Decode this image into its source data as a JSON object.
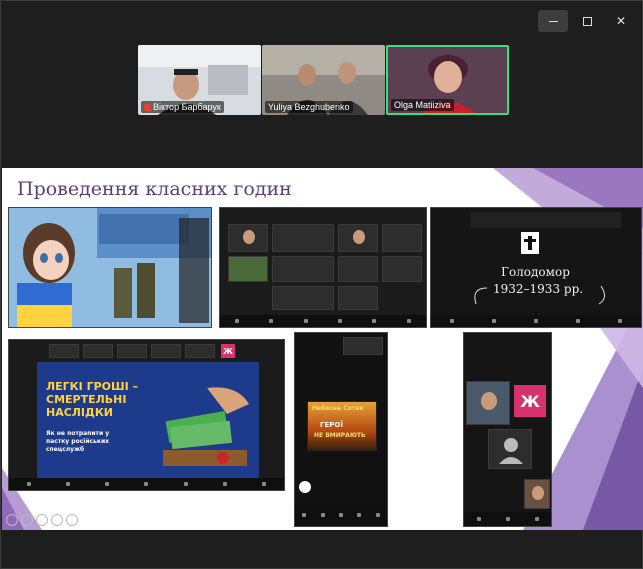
{
  "window": {
    "controls": {
      "minimize": "minimize",
      "maximize": "maximize",
      "close": "✕"
    }
  },
  "participants": [
    {
      "name": "Віктор Барбарук",
      "muted": true
    },
    {
      "name": "Yuliya Bezghubenko",
      "muted": false
    },
    {
      "name": "Olga Matiiziva",
      "muted": false,
      "active": true
    }
  ],
  "slide": {
    "title": "Проведення класних годин",
    "screens": {
      "holodomor": {
        "title": "Голодомор",
        "years": "1932–1933 рр."
      },
      "banner": {
        "headline": "ЛЕГКІ ГРОШІ – СМЕРТЕЛЬНІ НАСЛІДКИ",
        "subline": "Як не потрапити у пастку російських спецслужб"
      },
      "heroes": {
        "line1": "Небесна Сотня",
        "line2": "ГЕРОЇ",
        "line3": "НЕ ВМИРАЮТЬ"
      },
      "pink_letter": "Ж"
    }
  },
  "colors": {
    "accent_green": "#3ddc84",
    "title_purple": "#5a3f7a",
    "banner_blue": "#1e3a8a",
    "banner_yellow": "#ffd23f",
    "pink": "#d6336c"
  }
}
